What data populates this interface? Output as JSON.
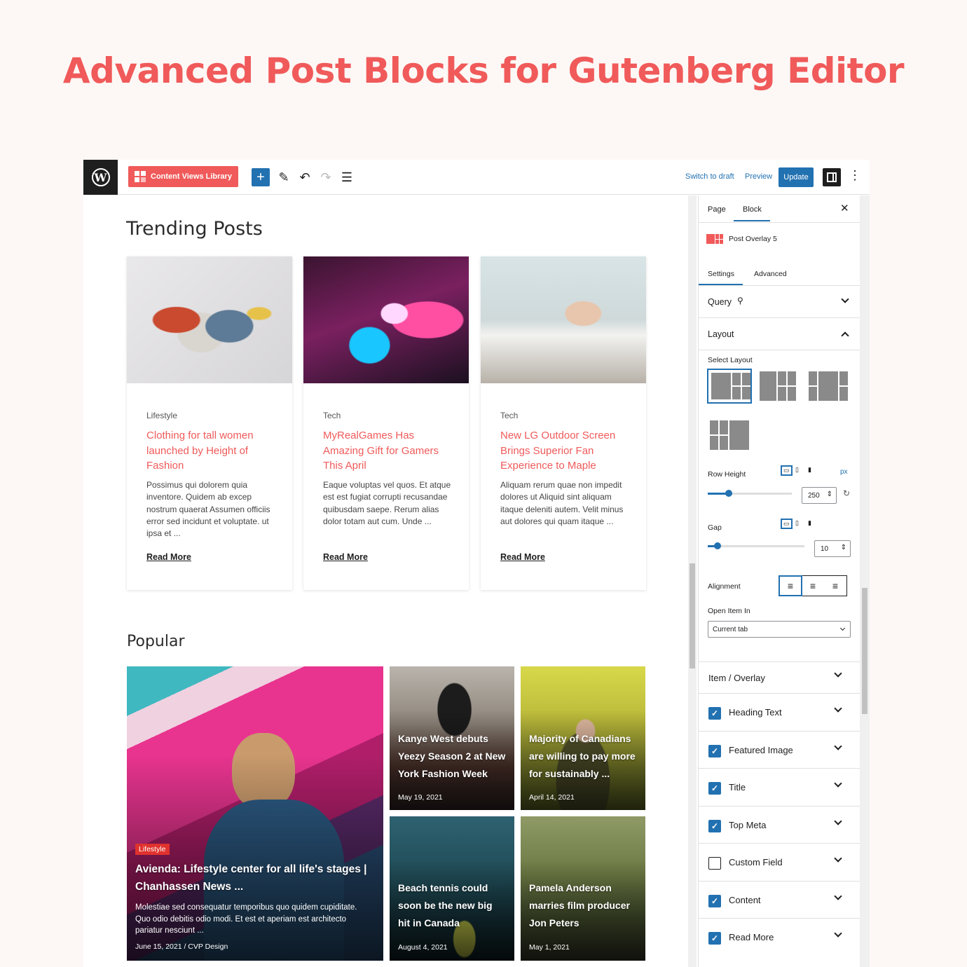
{
  "headline": "Advanced Post Blocks for Gutenberg Editor",
  "toolbar": {
    "content_views_label": "Content Views Library",
    "switch_to_draft": "Switch to draft",
    "preview": "Preview",
    "update": "Update"
  },
  "trending": {
    "title": "Trending Posts",
    "read_more": "Read More",
    "cards": [
      {
        "category": "Lifestyle",
        "title": "Clothing for tall women launched by Height of Fashion",
        "excerpt": "Possimus qui dolorem quia inventore. Quidem ab excep nostrum quaerat Assumen officiis error sed incidunt et voluptate. ut ipsa et ..."
      },
      {
        "category": "Tech",
        "title": "MyRealGames Has Amazing Gift for Gamers This April",
        "excerpt": "Eaque voluptas vel quos. Et atque est est fugiat corrupti recusandae quibusdam saepe. Rerum alias dolor totam aut cum. Unde ..."
      },
      {
        "category": "Tech",
        "title": "New LG Outdoor Screen Brings Superior Fan Experience to Maple",
        "excerpt": "Aliquam rerum quae non impedit dolores ut Aliquid sint aliquam itaque deleniti autem. Velit minus aut dolores qui quam itaque ..."
      }
    ]
  },
  "popular": {
    "title": "Popular",
    "featured": {
      "badge": "Lifestyle",
      "title": "Avienda: Lifestyle center for all life's stages | Chanhassen News ...",
      "excerpt": "Molestiae sed consequatur temporibus quo quidem cupiditate. Quo odio debitis odio modi. Et est et aperiam est architecto pariatur nesciunt ...",
      "meta": "June 15, 2021 / CVP Design"
    },
    "tiles": [
      {
        "title": "Kanye West debuts Yeezy Season 2 at New York Fashion Week",
        "date": "May 19, 2021"
      },
      {
        "title": "Majority of Canadians are willing to pay more for sustainably ...",
        "date": "April 14, 2021"
      },
      {
        "title": "Beach tennis could soon be the new big hit in Canada",
        "date": "August 4, 2021"
      },
      {
        "title": "Pamela Anderson marries film producer Jon Peters",
        "date": "May 1, 2021"
      }
    ]
  },
  "sidebar": {
    "tab_page": "Page",
    "tab_block": "Block",
    "block_name": "Post Overlay 5",
    "subtab_settings": "Settings",
    "subtab_advanced": "Advanced",
    "query": "Query",
    "layout": "Layout",
    "select_layout": "Select Layout",
    "row_height": "Row Height",
    "row_height_unit": "px",
    "row_height_value": "250",
    "row_height_fraction": 0.25,
    "gap": "Gap",
    "gap_value": "10",
    "gap_fraction": 0.1,
    "alignment": "Alignment",
    "open_item_in": "Open Item In",
    "open_item_value": "Current tab",
    "item_overlay": "Item / Overlay",
    "options": [
      {
        "label": "Heading Text",
        "checked": true
      },
      {
        "label": "Featured Image",
        "checked": true
      },
      {
        "label": "Title",
        "checked": true
      },
      {
        "label": "Top Meta",
        "checked": true
      },
      {
        "label": "Custom Field",
        "checked": false
      },
      {
        "label": "Content",
        "checked": true
      },
      {
        "label": "Read More",
        "checked": true
      }
    ]
  },
  "colors": {
    "accent": "#f05a5a",
    "wp_blue": "#2271b1",
    "badge_red": "#e0322e"
  },
  "icons": [
    "wordpress-logo-icon",
    "plus-icon",
    "pen-icon",
    "undo-icon",
    "redo-icon",
    "list-view-icon",
    "settings-panel-icon",
    "more-vertical-icon",
    "close-icon",
    "search-icon",
    "chevron-down-icon",
    "chevron-up-icon",
    "desktop-icon",
    "tablet-icon",
    "mobile-icon",
    "reset-icon",
    "align-left-icon",
    "align-center-icon",
    "align-right-icon"
  ]
}
